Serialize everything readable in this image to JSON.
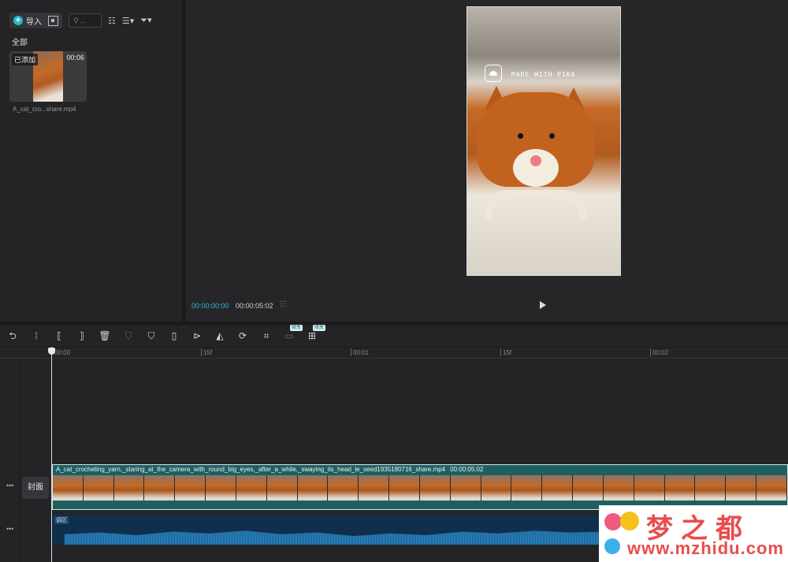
{
  "media": {
    "import_label": "导入",
    "search_placeholder": "...",
    "section_label": "全部",
    "item": {
      "badge": "已添加",
      "duration": "00:06",
      "name": "A_cat_cro...share.mp4"
    }
  },
  "player": {
    "watermark_text": "MADE WITH PIKA",
    "current_time": "00:00:00:00",
    "total_time": "00:00:05:02"
  },
  "timeline": {
    "free_tag": "限免",
    "ruler": [
      "00:00",
      "15f",
      "00:01",
      "15f",
      "00:02"
    ],
    "cover_label": "封面",
    "clip_name": "A_cat_crocheting_yarn,_staring_at_the_camera_with_round_big_eyes,_after_a_while,_swaying_its_head_le_seed1935180716_share.mp4",
    "clip_duration": "00:00:05:02",
    "audio_label": "调区"
  },
  "watermark": {
    "cn": "梦之都",
    "url": "www.mzhidu.com"
  },
  "colors": {
    "accent": "#2fb7d0",
    "clip": "#1f5f62",
    "audio": "#0f2f4d"
  },
  "icons": [
    "plus-icon",
    "qr-icon",
    "search-icon",
    "sort-icon",
    "filter-icon",
    "undo-icon",
    "split-icon",
    "trim-left-icon",
    "trim-right-icon",
    "delete-icon",
    "shield-icon",
    "play-circle-icon",
    "mirror-icon",
    "rotate-icon",
    "crop-icon",
    "play-icon"
  ]
}
